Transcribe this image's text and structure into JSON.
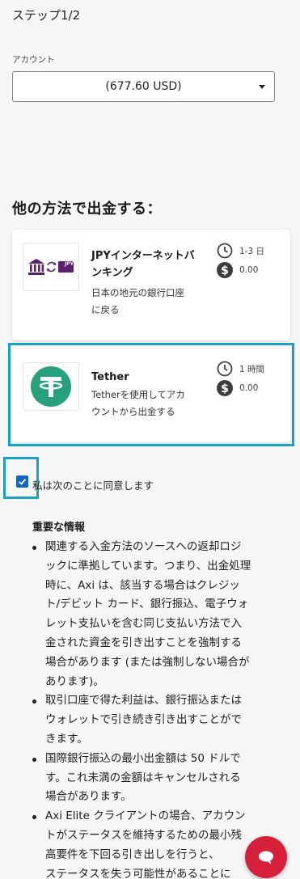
{
  "step": {
    "title": "ステップ1/2"
  },
  "account": {
    "label": "アカウント",
    "value": "(677.60 USD)"
  },
  "methods_section": {
    "title": "他の方法で出金する："
  },
  "methods": [
    {
      "name": "JPYインターネットバンキング",
      "name_line1": "JPYインターネットバ",
      "name_line2": "ンキング",
      "desc_line1": "日本の地元の銀行口座",
      "desc_line2": "に戻る",
      "time": "1-3 日",
      "fee": "0.00",
      "logo_badge": "JPY",
      "icon": "bank-transfer-jpy-icon"
    },
    {
      "name": "Tether",
      "desc_line1": "Tetherを使用してアカ",
      "desc_line2": "ウントから出金する",
      "time": "1 時間",
      "fee": "0.00",
      "icon": "tether-icon",
      "selected": true
    }
  ],
  "agreement": {
    "label": "私は次のことに同意します",
    "checked": true
  },
  "info": {
    "title": "重要な情報",
    "items": [
      {
        "lines": [
          "関連する入金方法のソースへの返却ロジ",
          "ックに準拠しています。つまり、出金処理",
          "時に、Axi は、該当する場合はクレジッ",
          "ト/デビット カード、銀行振込、電子ウォ",
          "レット支払いを含む同じ支払い方法で入",
          "金された資金を引き出すことを強制する",
          "場合があります (または強制しない場合が",
          "あります)。"
        ]
      },
      {
        "lines": [
          "取引口座で得た利益は、銀行振込または",
          "ウォレットで引き続き引き出すことがで",
          "きます。"
        ]
      },
      {
        "lines": [
          "国際銀行振込の最小出金額は 50 ドルで",
          "す。これ未満の金額はキャンセルされる",
          "場合があります。"
        ]
      },
      {
        "lines": [
          "Axi Elite クライアントの場合、アカウン",
          "トがステータスを維持するための最小残",
          "高要件を下回る引き出しを行うと、",
          "ステータスを失う可能性があることに"
        ]
      }
    ]
  },
  "colors": {
    "accent_outline": "#1aa0c0",
    "checkbox": "#1565c0",
    "chat_button": "#d6203b",
    "bank_logo": "#5b1f6b",
    "tether_green": "#26a17b"
  }
}
